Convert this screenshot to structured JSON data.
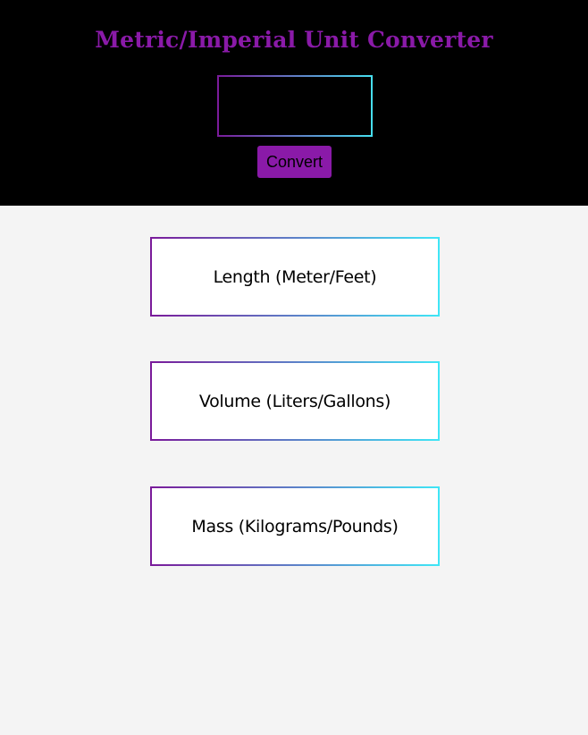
{
  "header": {
    "title": "Metric/Imperial Unit Converter",
    "input_value": "",
    "convert_label": "Convert"
  },
  "cards": [
    {
      "title": "Length (Meter/Feet)",
      "result": ""
    },
    {
      "title": "Volume (Liters/Gallons)",
      "result": ""
    },
    {
      "title": "Mass (Kilograms/Pounds)",
      "result": ""
    }
  ],
  "colors": {
    "accent": "#8a1aa8",
    "gradient_start": "#7a1a9a",
    "gradient_end": "#3fe6f6",
    "header_bg": "#000000",
    "page_bg": "#f4f4f4"
  }
}
